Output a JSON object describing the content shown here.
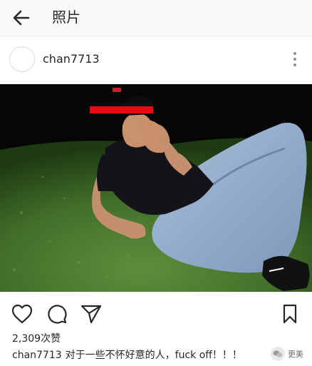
{
  "topbar": {
    "title": "照片",
    "back_icon": "arrow-left-icon"
  },
  "post": {
    "username": "chan7713",
    "more_icon": "more-vertical-icon",
    "likes": "2,309次赞",
    "caption_user": "chan7713",
    "caption_text": "对于一些不怀好意的人，fuck off！！！",
    "action_icons": [
      "heart-icon",
      "comment-icon",
      "share-icon",
      "bookmark-icon"
    ]
  },
  "watermark": {
    "text": "更美"
  },
  "colors": {
    "text": "#262626",
    "secondary": "#8e8e8e",
    "censor_bar": "#e01010",
    "grass": "#3f6b28",
    "jeans": "#8fa8c8"
  }
}
